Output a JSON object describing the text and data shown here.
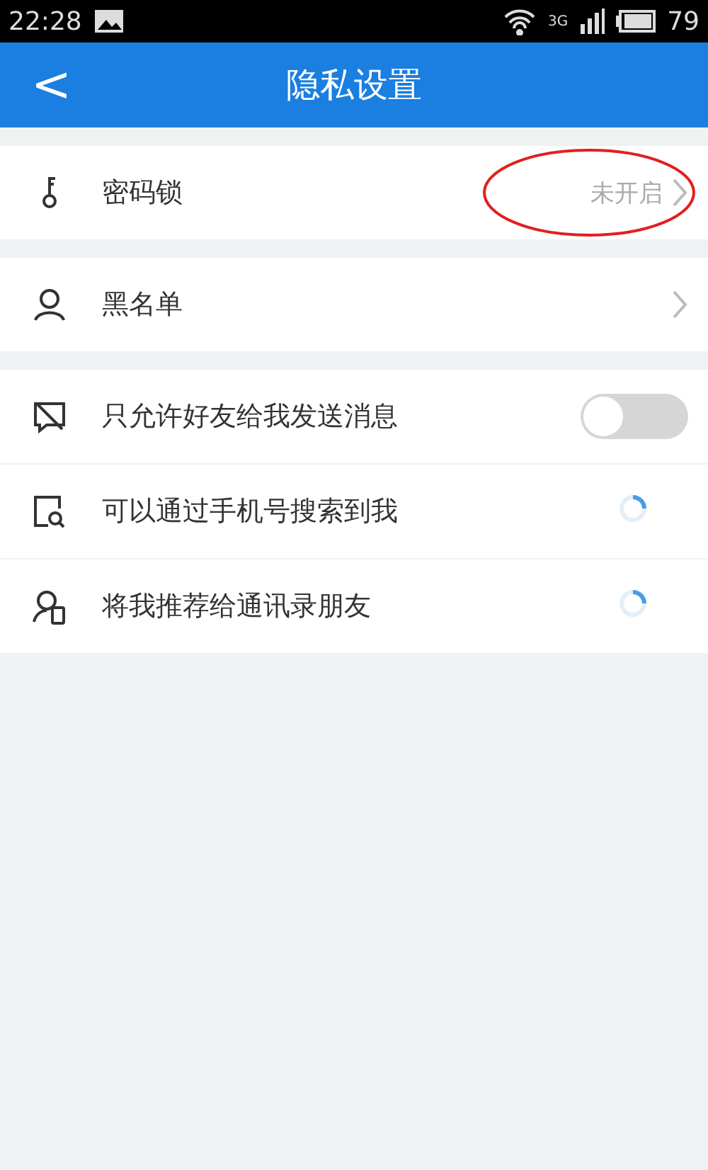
{
  "status_bar": {
    "time": "22:28",
    "network": "3G",
    "battery": "79"
  },
  "header": {
    "back": "<",
    "title": "隐私设置"
  },
  "groups": [
    {
      "items": [
        {
          "kind": "link",
          "label": "密码锁",
          "value": "未开启",
          "highlighted": true
        }
      ]
    },
    {
      "items": [
        {
          "kind": "link",
          "label": "黑名单",
          "highlighted": false
        }
      ]
    },
    {
      "items": [
        {
          "kind": "toggle",
          "label": "只允许好友给我发送消息",
          "on": false
        },
        {
          "kind": "loading",
          "label": "可以通过手机号搜索到我"
        },
        {
          "kind": "loading",
          "label": "将我推荐给通讯录朋友"
        }
      ]
    }
  ]
}
